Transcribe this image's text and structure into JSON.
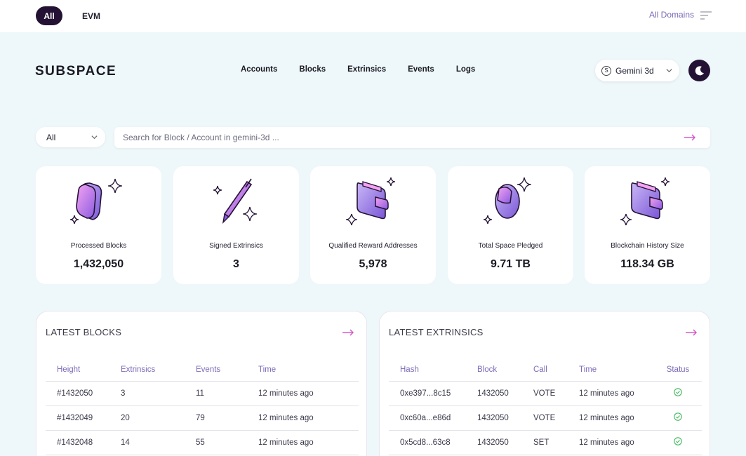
{
  "topbar": {
    "tabs": [
      "All",
      "EVM"
    ],
    "active_tab": "All",
    "domains_label": "All Domains"
  },
  "header": {
    "logo": "SUBSPACE",
    "nav": [
      "Accounts",
      "Blocks",
      "Extrinsics",
      "Events",
      "Logs"
    ],
    "network": {
      "badge": "S",
      "label": "Gemini 3d"
    }
  },
  "search": {
    "type": "All",
    "placeholder": "Search for Block / Account in gemini-3d ..."
  },
  "stats": [
    {
      "label": "Processed Blocks",
      "value": "1,432,050",
      "icon": "gem-icon"
    },
    {
      "label": "Signed Extrinsics",
      "value": "3",
      "icon": "pen-icon"
    },
    {
      "label": "Qualified Reward Addresses",
      "value": "5,978",
      "icon": "wallet-icon"
    },
    {
      "label": "Total Space Pledged",
      "value": "9.71 TB",
      "icon": "disc-icon"
    },
    {
      "label": "Blockchain History Size",
      "value": "118.34 GB",
      "icon": "wallet-icon"
    }
  ],
  "latest_blocks": {
    "title": "LATEST BLOCKS",
    "columns": [
      "Height",
      "Extrinsics",
      "Events",
      "Time"
    ],
    "rows": [
      [
        "#1432050",
        "3",
        "11",
        "12 minutes ago"
      ],
      [
        "#1432049",
        "20",
        "79",
        "12 minutes ago"
      ],
      [
        "#1432048",
        "14",
        "55",
        "12 minutes ago"
      ]
    ]
  },
  "latest_extrinsics": {
    "title": "LATEST EXTRINSICS",
    "columns": [
      "Hash",
      "Block",
      "Call",
      "Time",
      "Status"
    ],
    "rows": [
      [
        "0xe397...8c15",
        "1432050",
        "VOTE",
        "12 minutes ago"
      ],
      [
        "0xc60a...e86d",
        "1432050",
        "VOTE",
        "12 minutes ago"
      ],
      [
        "0x5cd8...63c8",
        "1432050",
        "SET",
        "12 minutes ago"
      ]
    ]
  },
  "colors": {
    "accent": "#241235",
    "link": "#7d6bb8",
    "arrow": "#d64fc9",
    "success": "#3fb95c"
  }
}
